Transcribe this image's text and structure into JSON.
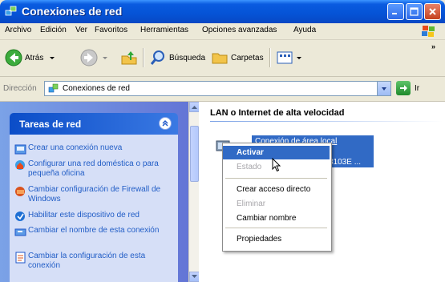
{
  "window": {
    "title": "Conexiones de red"
  },
  "menubar": {
    "items": [
      "Archivo",
      "Edición",
      "Ver",
      "Favoritos",
      "Herramientas",
      "Opciones avanzadas",
      "Ayuda"
    ]
  },
  "toolbar": {
    "back": "Atrás",
    "search": "Búsqueda",
    "folders": "Carpetas"
  },
  "address": {
    "label": "Dirección",
    "value": "Conexiones de red",
    "go": "Ir"
  },
  "sidebar": {
    "title": "Tareas de red",
    "tasks": [
      "Crear una conexión nueva",
      "Configurar una red doméstica o para pequeña oficina",
      "Cambiar configuración de Firewall de Windows",
      "Habilitar este dispositivo de red",
      "Cambiar el nombre de esta conexión",
      "Cambiar la configuración de esta conexión"
    ]
  },
  "content": {
    "group_header": "LAN o Internet de alta velocidad",
    "connection": {
      "name": "Conexión de área local",
      "detail_tail": "8103E ..."
    }
  },
  "context_menu": {
    "items": {
      "activar": "Activar",
      "estado": "Estado",
      "crear_acceso": "Crear acceso directo",
      "eliminar": "Eliminar",
      "cambiar_nombre": "Cambiar nombre",
      "propiedades": "Propiedades"
    }
  },
  "colors": {
    "titlebar": "#0553d6",
    "selection": "#316ac5",
    "task_link": "#215dc6",
    "sidebar_bg": "#6375d6"
  }
}
